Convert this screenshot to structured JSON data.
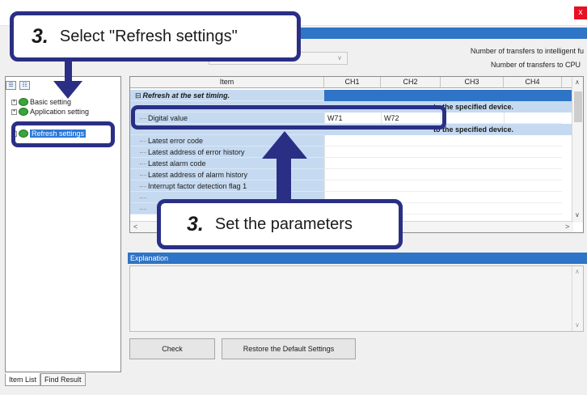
{
  "window": {
    "close_label": "x"
  },
  "toolbar_icons": [
    "tree-expand-icon",
    "tree-collapse-icon"
  ],
  "tree": {
    "items": [
      {
        "label": "Basic setting",
        "expander": "+"
      },
      {
        "label": "Application setting",
        "expander": "+"
      },
      {
        "label": "Refresh settings",
        "expander": "+",
        "selected": true
      }
    ]
  },
  "left_tabs": [
    "Item List",
    "Find Result"
  ],
  "header": {
    "transfer_intelligent": "Number of transfers to intelligent fu",
    "transfer_cpu": "Number of transfers to CPU"
  },
  "grid": {
    "columns": [
      "Item",
      "CH1",
      "CH2",
      "CH3",
      "CH4"
    ],
    "section_title": "Refresh at the set timing.",
    "band_text_1": "to the specified device.",
    "band_text_2": "to the specified device.",
    "digital_value": {
      "label": "Digital value",
      "ch1": "W71",
      "ch2": "W72"
    },
    "rows": [
      "Latest error code",
      "Latest address of error history",
      "Latest alarm code",
      "Latest address of alarm history",
      "Interrupt factor detection flag 1"
    ]
  },
  "explanation": {
    "title": "Explanation"
  },
  "buttons": {
    "check": "Check",
    "restore": "Restore the Default Settings"
  },
  "callouts": {
    "top": {
      "step": "3.",
      "text": "Select \"Refresh settings\""
    },
    "middle": {
      "step": "3.",
      "text": "Set the parameters"
    }
  },
  "colors": {
    "callout_border": "#2a2f85",
    "accent_blue": "#2e74c7",
    "row_blue": "#c5daf1"
  }
}
